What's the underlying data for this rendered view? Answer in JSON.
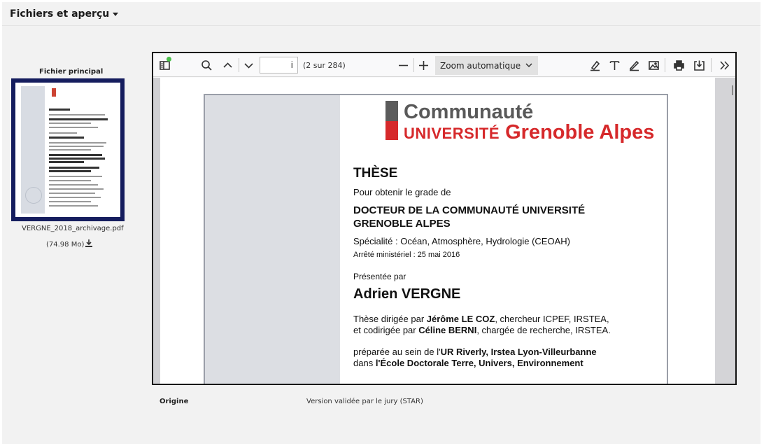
{
  "panel": {
    "title": "Fichiers et aperçu"
  },
  "file": {
    "main_label": "Fichier principal",
    "name": "VERGNE_2018_archivage.pdf",
    "size": "(74.98 Mo)",
    "download_icon": "download-icon"
  },
  "viewer": {
    "toolbar": {
      "sidebar_icon": "sidebar-toggle-icon",
      "search_icon": "search-icon",
      "prev_icon": "chevron-up-icon",
      "next_icon": "chevron-down-icon",
      "page_value": "i",
      "page_count": "(2 sur 284)",
      "zoom_out_icon": "minus-icon",
      "zoom_in_icon": "plus-icon",
      "zoom_value": "Zoom automatique",
      "highlight_icon": "highlight-icon",
      "text_icon": "text-icon",
      "draw_icon": "pen-icon",
      "image_icon": "image-icon",
      "print_icon": "print-icon",
      "save_icon": "save-icon",
      "more_icon": "double-chevron-right-icon"
    },
    "document": {
      "logo_line1": "Communauté",
      "logo_line2_small": "UNIVERSITÉ",
      "logo_line2": "Grenoble Alpes",
      "title": "THÈSE",
      "grade_intro": "Pour obtenir le grade de",
      "grade_line1": "DOCTEUR DE LA COMMUNAUTÉ UNIVERSITÉ",
      "grade_line2": "GRENOBLE ALPES",
      "speciality": "Spécialité : Océan, Atmosphère, Hydrologie (CEOAH)",
      "arrete": "Arrêté ministériel : 25 mai 2016",
      "presented_by": "Présentée par",
      "author": "Adrien VERGNE",
      "dir_prefix": "Thèse dirigée par ",
      "director": "Jérôme LE COZ",
      "dir_suffix": ", chercheur ICPEF, IRSTEA,",
      "codir_prefix": "et codirigée par ",
      "codirector": "Céline BERNI",
      "codir_suffix": ", chargée de recherche, IRSTEA.",
      "prep_prefix": "préparée au sein de l'",
      "lab": "UR Riverly, Irstea Lyon-Villeurbanne",
      "school_prefix": "dans ",
      "school": "l'École Doctorale Terre, Univers, Environnement"
    }
  },
  "metadata": {
    "origin_label": "Origine",
    "origin_value": "Version validée par le jury (STAR)"
  },
  "colors": {
    "thumb_border": "#151d5e",
    "brand_red": "#d6292b",
    "brand_grey": "#595959",
    "panel_bg": "#f2f2f2"
  }
}
